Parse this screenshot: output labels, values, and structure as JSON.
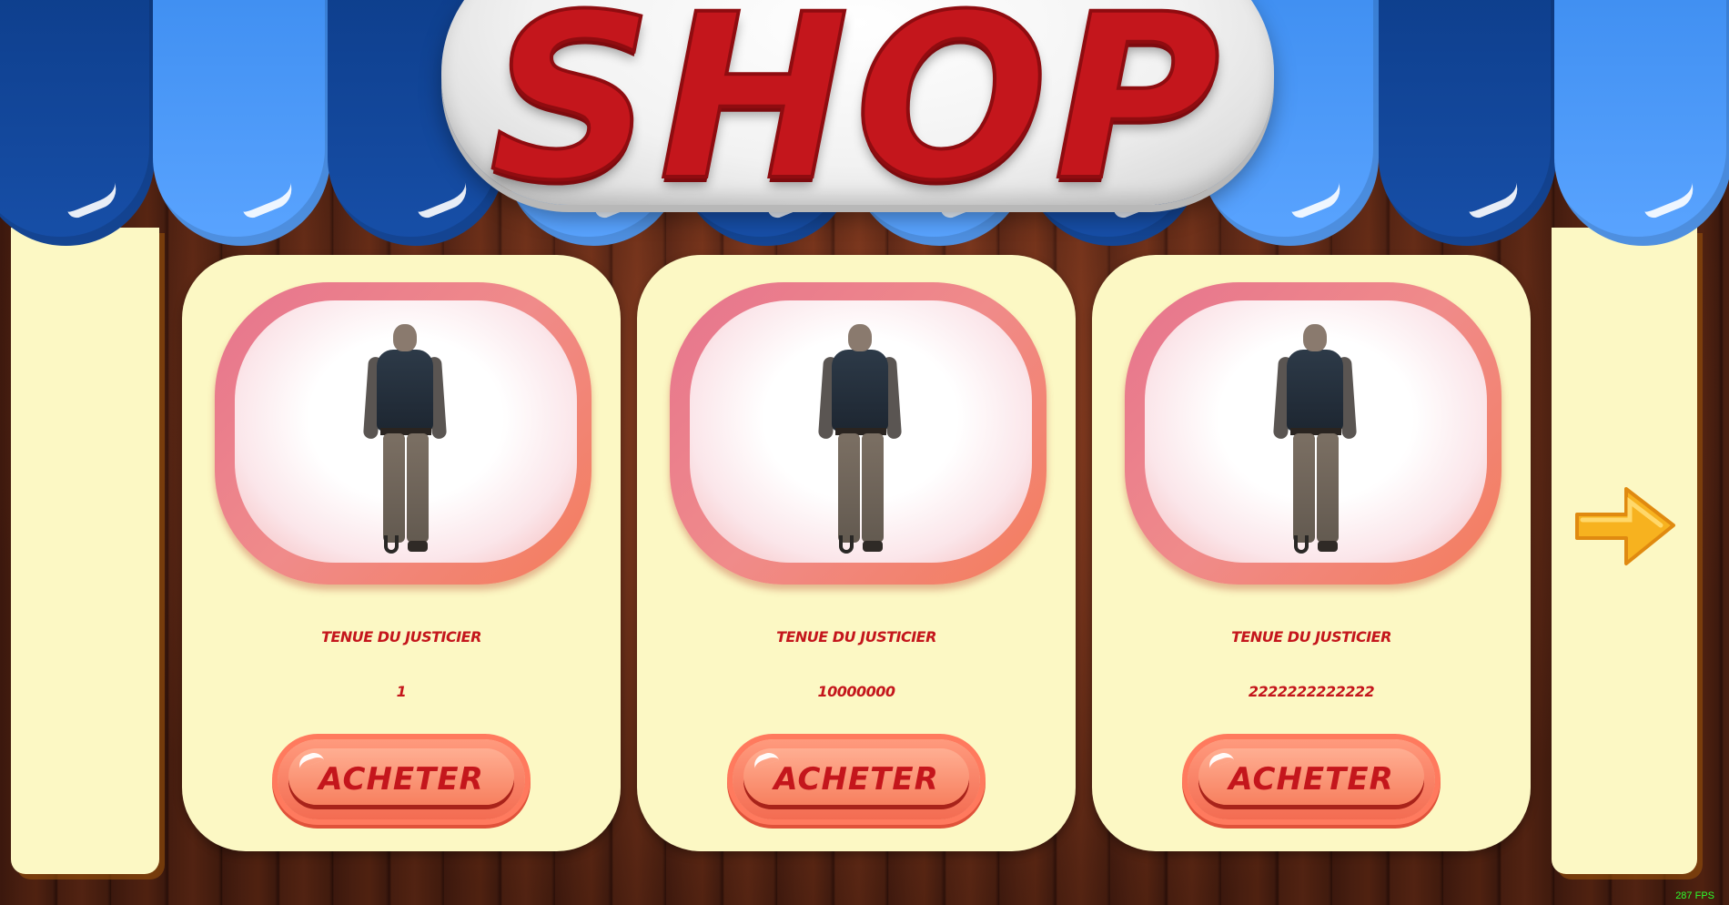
{
  "header": {
    "title": "SHOP"
  },
  "items": [
    {
      "name": "TENUE DU JUSTICIER",
      "price": "1",
      "button": "ACHETER"
    },
    {
      "name": "TENUE DU JUSTICIER",
      "price": "10000000",
      "button": "ACHETER"
    },
    {
      "name": "TENUE DU JUSTICIER",
      "price": "2222222222222",
      "button": "ACHETER"
    }
  ],
  "navigation": {
    "next_icon": "arrow-right-icon"
  },
  "hud": {
    "fps": "287 FPS"
  },
  "colors": {
    "awning_dark": "#0d3d8a",
    "awning_light": "#4d9bff",
    "card_bg": "#fcf8c4",
    "text_red": "#c4161c",
    "button_orange": "#f7805f",
    "arrow_yellow": "#f7b21f",
    "fps_green": "#2cff2c"
  }
}
